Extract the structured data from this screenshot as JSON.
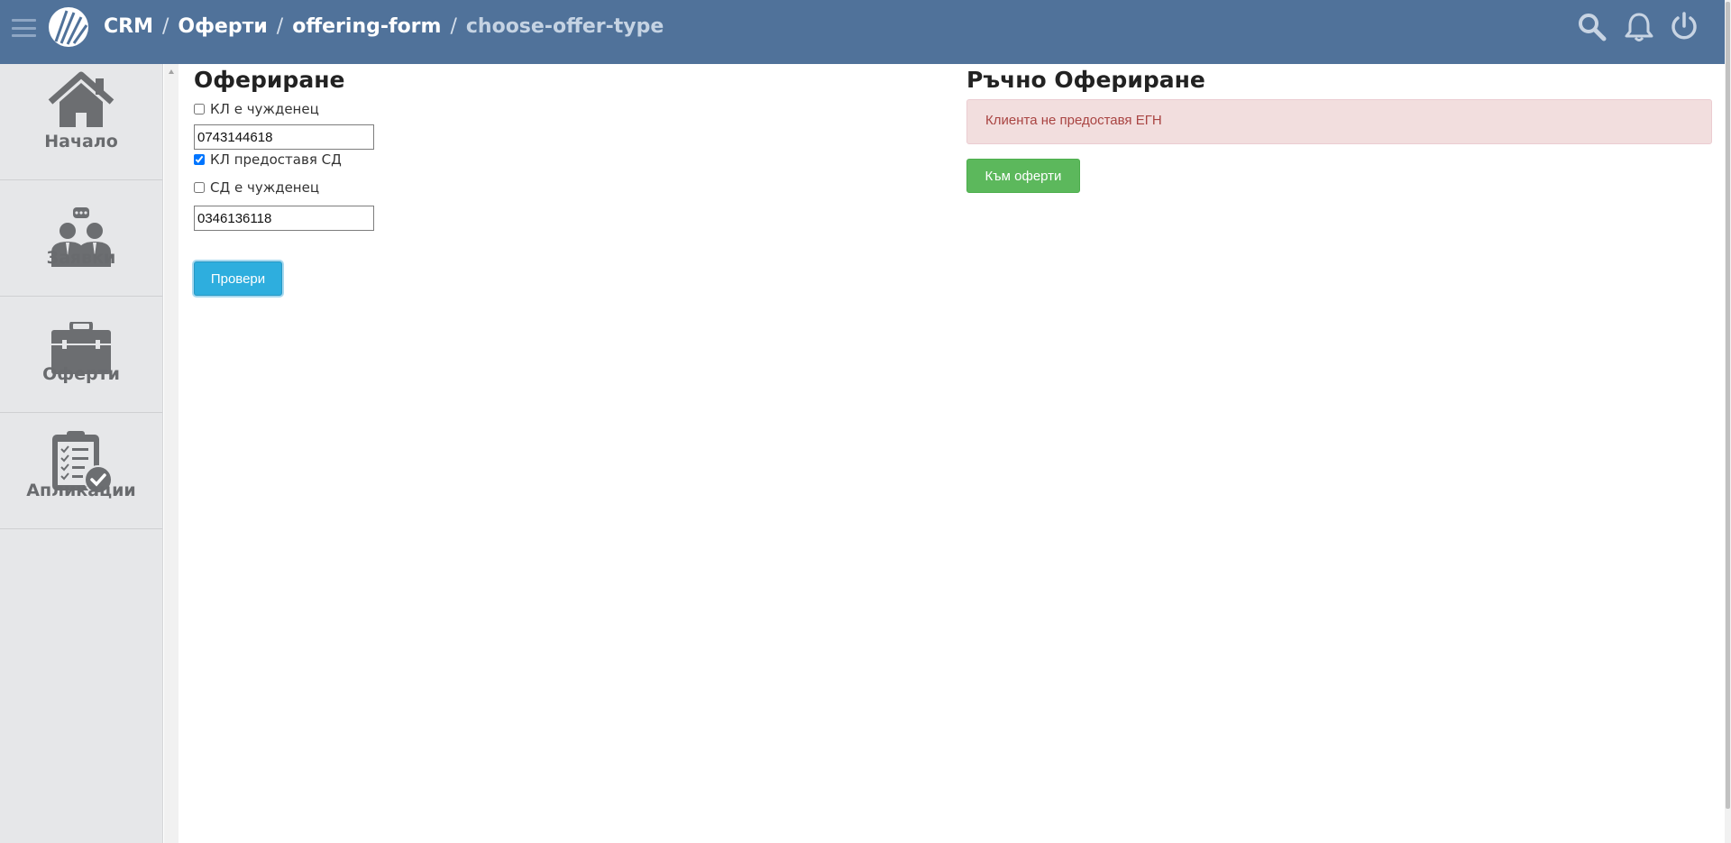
{
  "header": {
    "breadcrumbs": [
      "CRM",
      "Оферти",
      "offering-form"
    ],
    "current": "choose-offer-type",
    "separator": "/",
    "icons": [
      "menu-icon",
      "logo",
      "search-icon",
      "bell-icon",
      "power-icon"
    ],
    "bg_color": "#50729a"
  },
  "sidebar": {
    "items": [
      {
        "label": "Начало",
        "icon": "home-icon"
      },
      {
        "label": "Заявки",
        "icon": "people-chat-icon"
      },
      {
        "label": "Оферти",
        "icon": "briefcase-icon"
      },
      {
        "label": "Апликации",
        "icon": "clipboard-check-icon"
      }
    ]
  },
  "offering": {
    "title": "Офериране",
    "client_foreign_label": "КЛ е чужденец",
    "client_foreign_checked": false,
    "client_id_value": "0743144618",
    "provides_cd_label": "КЛ предоставя СД",
    "provides_cd_checked": true,
    "cd_foreign_label": "СД е чужденец",
    "cd_foreign_checked": false,
    "cd_id_value": "0346136118",
    "check_button": "Провери"
  },
  "manual": {
    "title": "Ръчно Офериране",
    "alert": "Клиента не предоставя ЕГН",
    "offers_button": "Към оферти"
  },
  "colors": {
    "accent_blue": "#2eaede",
    "success_green": "#5cb85c",
    "alert_bg": "#f2dede",
    "alert_text": "#a94442"
  }
}
